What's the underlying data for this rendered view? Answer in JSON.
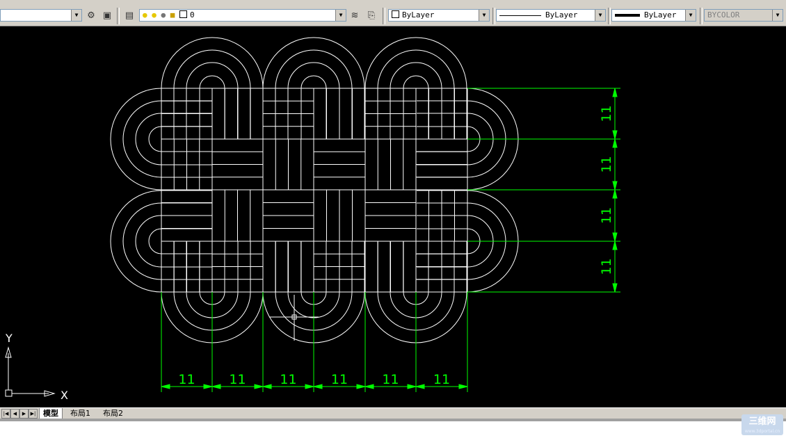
{
  "toolbar": {
    "layer_value": "0",
    "color_value": "ByLayer",
    "linetype_value": "ByLayer",
    "lineweight_value": "ByLayer",
    "plotstyle_value": "BYCOLOR"
  },
  "drawing": {
    "dim_text": "11",
    "horizontal_dims": [
      "11",
      "11",
      "11",
      "11",
      "11",
      "11"
    ],
    "vertical_dims": [
      "11",
      "11",
      "11",
      "11"
    ],
    "ucs": {
      "x_label": "X",
      "y_label": "Y"
    },
    "colors": {
      "geometry": "#ffffff",
      "dimensions": "#00ff00",
      "background": "#000000"
    }
  },
  "tabs": [
    {
      "label": "模型",
      "active": true
    },
    {
      "label": "布局1",
      "active": false
    },
    {
      "label": "布局2",
      "active": false
    }
  ],
  "watermark": {
    "title": "三维网",
    "sub": "www.3dportal.cn"
  }
}
